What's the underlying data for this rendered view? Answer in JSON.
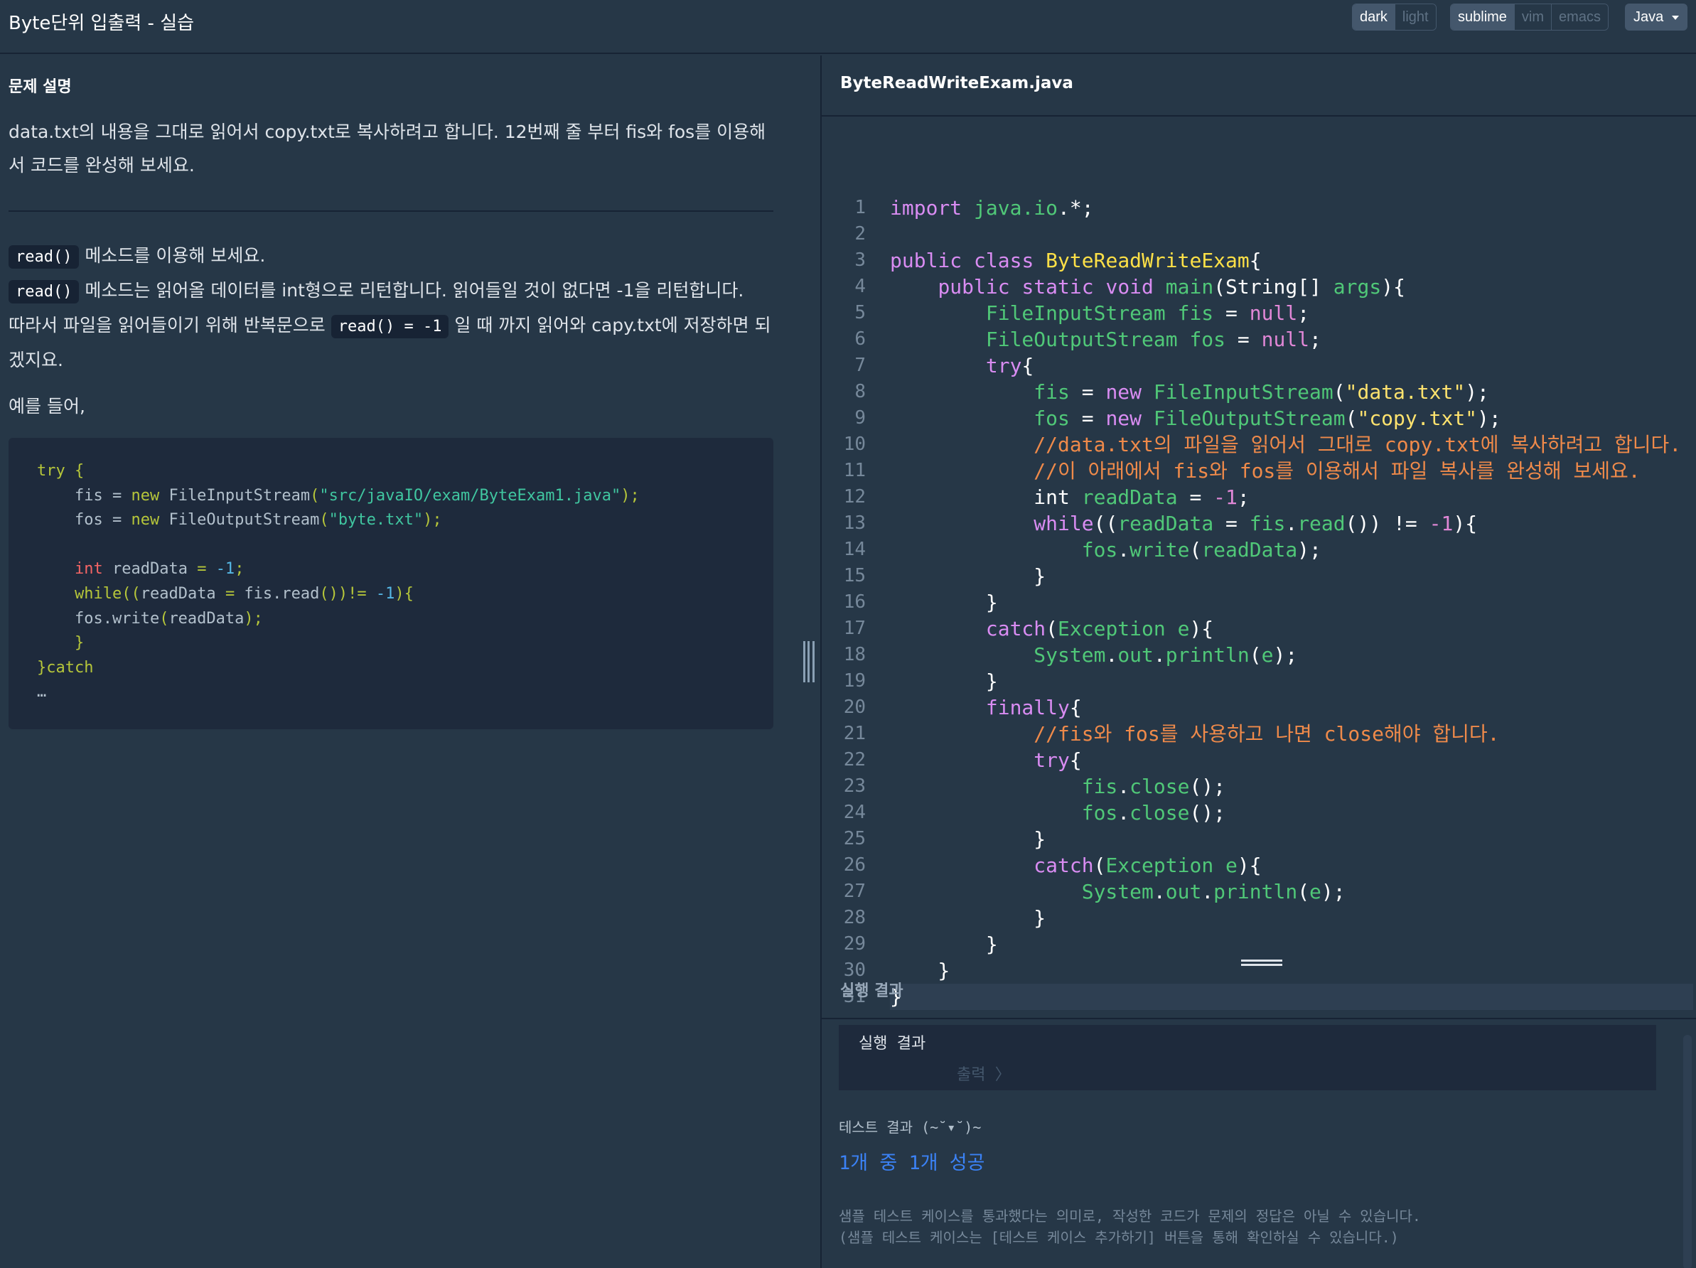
{
  "header": {
    "title": "Byte단위 입출력 - 실습",
    "theme_options": [
      "dark",
      "light"
    ],
    "keymap_options": [
      "sublime",
      "vim",
      "emacs"
    ],
    "language": "Java"
  },
  "problem": {
    "heading": "문제 설명",
    "description": "data.txt의 내용을 그대로 읽어서 copy.txt로 복사하려고 합니다. 12번째 줄 부터 fis와 fos를 이용해서 코드를 완성해 보세요.",
    "hint_line1_code": "read()",
    "hint_line1_text": " 메소드를 이용해 보세요.",
    "hint_line2_code": "read()",
    "hint_line2_text": " 메소드는 읽어올 데이터를 int형으로 리턴합니다. 읽어들일 것이 없다면 -1을 리턴합니다.",
    "hint_line3_pre": "따라서 파일을 읽어들이기 위해 반복문으로 ",
    "hint_line3_code": "read() = -1",
    "hint_line3_post": " 일 때 까지 읽어와 capy.txt에 저장하면 되겠지요.",
    "example_label": "예를 들어,",
    "example_code": {
      "l1": "try {",
      "l2a": "    fis = ",
      "l2b": "new",
      "l2c": " FileInputStream",
      "l2d": "(",
      "l2e": "\"src/javaIO/exam/ByteExam1.java\"",
      "l2f": ");",
      "l3a": "    fos = ",
      "l3b": "new",
      "l3c": " FileOutputStream",
      "l3d": "(",
      "l3e": "\"byte.txt\"",
      "l3f": ");",
      "l5a": "    ",
      "l5b": "int",
      "l5c": " readData ",
      "l5d": "= ",
      "l5e": "-1",
      "l5f": ";",
      "l6a": "    ",
      "l6b": "while",
      "l6c": "((",
      "l6d": "readData ",
      "l6e": "= ",
      "l6f": "fis.read",
      "l6g": "())!= ",
      "l6h": "-1",
      "l6i": "){",
      "l7a": "    fos.write",
      "l7b": "(",
      "l7c": "readData",
      "l7d": ");",
      "l8": "    }",
      "l9": "}catch",
      "l10": "…"
    }
  },
  "editor": {
    "filename": "ByteReadWriteExam.java",
    "line_numbers": [
      "1",
      "2",
      "3",
      "4",
      "5",
      "6",
      "7",
      "8",
      "9",
      "10",
      "11",
      "12",
      "13",
      "14",
      "15",
      "16",
      "17",
      "18",
      "19",
      "20",
      "21",
      "22",
      "23",
      "24",
      "25",
      "26",
      "27",
      "28",
      "29",
      "30",
      "31"
    ]
  },
  "code_text": {
    "import": "import",
    "java_io": "java.io",
    "import_tail": ".*;",
    "public": "public",
    "class": "class",
    "classname": "ByteReadWriteExam",
    "brace_open": "{",
    "static": "static",
    "void": "void",
    "main": "main",
    "main_args": "(String[] ",
    "args": "args",
    "close_paren_brace": "){",
    "fis_type": "FileInputStream",
    "fos_type": "FileOutputStream",
    "fis": "fis",
    "fos": "fos",
    "null": "null",
    "try": "try",
    "new": "new",
    "data_txt": "\"data.txt\"",
    "copy_txt": "\"copy.txt\"",
    "comment1": "//data.txt의 파일을 읽어서 그대로 copy.txt에 복사하려고 합니다.",
    "comment2": "//이 아래에서 fis와 fos를 이용해서 파일 복사를 완성해 보세요.",
    "int": "int",
    "readData": "readData",
    "minus_one": "-1",
    "while": "while",
    "read": "read",
    "write": "write",
    "catch": "catch",
    "Exception": "Exception",
    "e": "e",
    "System": "System",
    "out": "out",
    "println": "println",
    "finally": "finally",
    "comment3": "//fis와 fos를 사용하고 나면 close해야 합니다.",
    "close": "close"
  },
  "result": {
    "title": "실행 결과",
    "console_label": "실행 결과",
    "console_output": "출력 〉",
    "test_label": "테스트 결과 (~˘▾˘)~",
    "test_summary": "1개 중 1개 성공",
    "note_line1": "샘플 테스트 케이스를 통과했다는 의미로, 작성한 코드가 문제의 정답은 아닐 수 있습니다.",
    "note_line2": "(샘플 테스트 케이스는 [테스트 케이스 추가하기] 버튼을 통해 확인하실 수 있습니다.)"
  }
}
